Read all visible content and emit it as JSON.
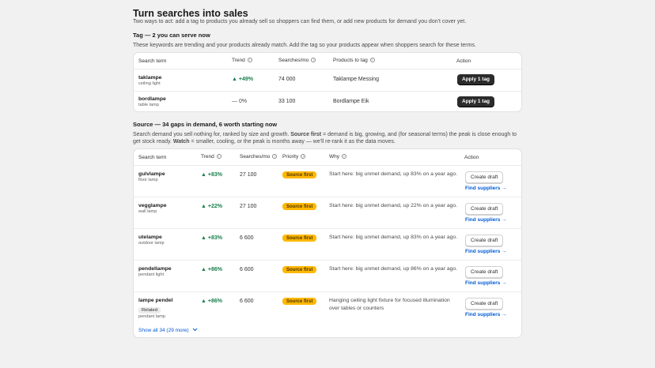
{
  "page": {
    "title": "Turn searches into sales",
    "subtitle": "Two ways to act: add a tag to products you already sell so shoppers can find them, or add new products for demand you don't cover yet."
  },
  "tag_section": {
    "title": "Tag — 2 you can serve now",
    "description": "These keywords are trending and your products already match. Add the tag so your products appear when shoppers search for these terms.",
    "columns": {
      "term": "Search term",
      "trend": "Trend",
      "searches": "Searches/mo",
      "products": "Products to tag",
      "action": "Action"
    },
    "rows": [
      {
        "term": "taklampe",
        "sub": "ceiling light",
        "trend": "▲ +49%",
        "searches": "74 000",
        "product": "Taklampe Messing",
        "action": "Apply 1 tag"
      },
      {
        "term": "bordlampe",
        "sub": "table lamp",
        "trend": "— 0%",
        "searches": "33 100",
        "product": "Bordlampe Eik",
        "action": "Apply 1 tag"
      }
    ]
  },
  "source_section": {
    "title": "Source — 34 gaps in demand, 6 worth starting now",
    "desc_1": "Search demand you sell nothing for, ranked by size and growth. ",
    "desc_bold_1": "Source first",
    "desc_2": " = demand is big, growing, and (for seasonal terms) the peak is close enough to get stock ready. ",
    "desc_bold_2": "Watch",
    "desc_3": " = smaller, cooling, or the peak is months away — we'll re-rank it as the data moves.",
    "columns": {
      "term": "Search term",
      "trend": "Trend",
      "searches": "Searches/mo",
      "priority": "Priority",
      "why": "Why",
      "action": "Action"
    },
    "rows": [
      {
        "term": "gulvlampe",
        "sub": "floor lamp",
        "trend": "▲ +83%",
        "searches": "27 100",
        "priority": "Source first",
        "why": "Start here: big unmet demand, up 83% on a year ago.",
        "create": "Create draft",
        "find": "Find suppliers →"
      },
      {
        "term": "vegglampe",
        "sub": "wall lamp",
        "trend": "▲ +22%",
        "searches": "27 100",
        "priority": "Source first",
        "why": "Start here: big unmet demand, up 22% on a year ago.",
        "create": "Create draft",
        "find": "Find suppliers →"
      },
      {
        "term": "utelampe",
        "sub": "outdoor lamp",
        "trend": "▲ +83%",
        "searches": "6 600",
        "priority": "Source first",
        "why": "Start here: big unmet demand, up 83% on a year ago.",
        "create": "Create draft",
        "find": "Find suppliers →"
      },
      {
        "term": "pendellampe",
        "sub": "pendant light",
        "trend": "▲ +86%",
        "searches": "6 600",
        "priority": "Source first",
        "why": "Start here: big unmet demand, up 86% on a year ago.",
        "create": "Create draft",
        "find": "Find suppliers →"
      },
      {
        "term": "lampe pendel",
        "related": "Related",
        "sub": "pendant lamp",
        "trend": "▲ +86%",
        "searches": "6 600",
        "priority": "Source first",
        "why": "Hanging ceiling light fixture for focused illumination over tables or counters",
        "create": "Create draft",
        "find": "Find suppliers →"
      }
    ],
    "show_all": "Show all 34 (29 more)"
  },
  "icons": {
    "info": "info-icon",
    "chevron": "chevron-down-icon"
  },
  "colors": {
    "accent_link": "#005bd3",
    "trend_up": "#1a7f4b",
    "badge": "#ffb800",
    "button_dark": "#2b2b2b"
  }
}
